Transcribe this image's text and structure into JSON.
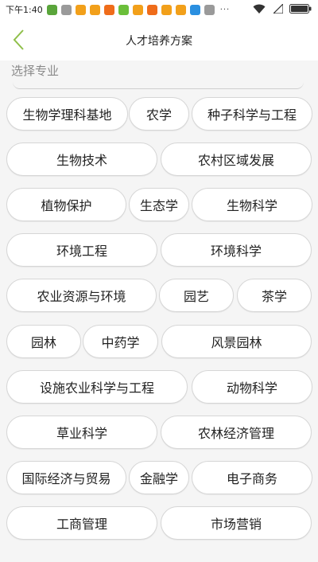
{
  "status_bar": {
    "time": "下午1:40",
    "dots": "···",
    "notification_icons": [
      {
        "name": "app-icon-1",
        "color": "#5aa53b"
      },
      {
        "name": "app-icon-2",
        "color": "#9a9a9a"
      },
      {
        "name": "app-icon-3",
        "color": "#f2a01a"
      },
      {
        "name": "app-icon-4",
        "color": "#f2a01a"
      },
      {
        "name": "app-icon-5",
        "color": "#ef6c1a"
      },
      {
        "name": "app-icon-6",
        "color": "#6bbf3a"
      },
      {
        "name": "app-icon-7",
        "color": "#f2a01a"
      },
      {
        "name": "app-icon-8",
        "color": "#ef6c1a"
      },
      {
        "name": "app-icon-9",
        "color": "#f2a01a"
      },
      {
        "name": "app-icon-10",
        "color": "#f2a01a"
      },
      {
        "name": "app-icon-11",
        "color": "#2a8fe0"
      },
      {
        "name": "app-icon-12",
        "color": "#9a9a9a"
      }
    ]
  },
  "header": {
    "title": "人才培养方案",
    "back_icon": "chevron-left-icon",
    "accent_color": "#8fbf4a"
  },
  "section": {
    "label": "选择专业"
  },
  "majors": {
    "rows": [
      [
        "生物学理科基地",
        "农学",
        "种子科学与工程"
      ],
      [
        "生物技术",
        "农村区域发展"
      ],
      [
        "植物保护",
        "生态学",
        "生物科学"
      ],
      [
        "环境工程",
        "环境科学"
      ],
      [
        "农业资源与环境",
        "园艺",
        "茶学"
      ],
      [
        "园林",
        "中药学",
        "风景园林"
      ],
      [
        "设施农业科学与工程",
        "动物科学"
      ],
      [
        "草业科学",
        "农林经济管理"
      ],
      [
        "国际经济与贸易",
        "金融学",
        "电子商务"
      ],
      [
        "工商管理",
        "市场营销"
      ]
    ]
  }
}
